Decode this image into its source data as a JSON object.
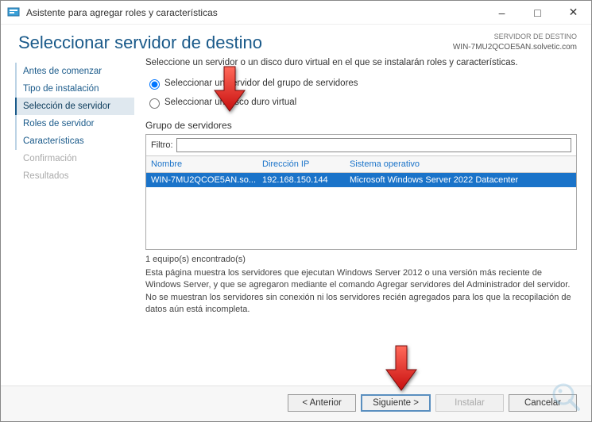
{
  "window": {
    "title": "Asistente para agregar roles y características"
  },
  "header": {
    "page_title": "Seleccionar servidor de destino",
    "dest_label": "SERVIDOR DE DESTINO",
    "dest_name": "WIN-7MU2QCOE5AN.solvetic.com"
  },
  "sidebar": {
    "items": [
      {
        "label": "Antes de comenzar"
      },
      {
        "label": "Tipo de instalación"
      },
      {
        "label": "Selección de servidor"
      },
      {
        "label": "Roles de servidor"
      },
      {
        "label": "Características"
      },
      {
        "label": "Confirmación"
      },
      {
        "label": "Resultados"
      }
    ]
  },
  "main": {
    "instruction": "Seleccione un servidor o un disco duro virtual en el que se instalarán roles y características.",
    "radio_pool": "Seleccionar un servidor del grupo de servidores",
    "radio_vhd": "Seleccionar un disco duro virtual",
    "group_label": "Grupo de servidores",
    "filter_label": "Filtro:",
    "filter_value": "",
    "columns": {
      "name": "Nombre",
      "ip": "Dirección IP",
      "os": "Sistema operativo"
    },
    "rows": [
      {
        "name": "WIN-7MU2QCOE5AN.so...",
        "ip": "192.168.150.144",
        "os": "Microsoft Windows Server 2022 Datacenter"
      }
    ],
    "count_text": "1 equipo(s) encontrado(s)",
    "footnote": "Esta página muestra los servidores que ejecutan Windows Server 2012 o una versión más reciente de Windows Server, y que se agregaron mediante el comando Agregar servidores del Administrador del servidor. No se muestran los servidores sin conexión ni los servidores recién agregados para los que la recopilación de datos aún está incompleta."
  },
  "footer": {
    "previous": "< Anterior",
    "next": "Siguiente >",
    "install": "Instalar",
    "cancel": "Cancelar"
  }
}
